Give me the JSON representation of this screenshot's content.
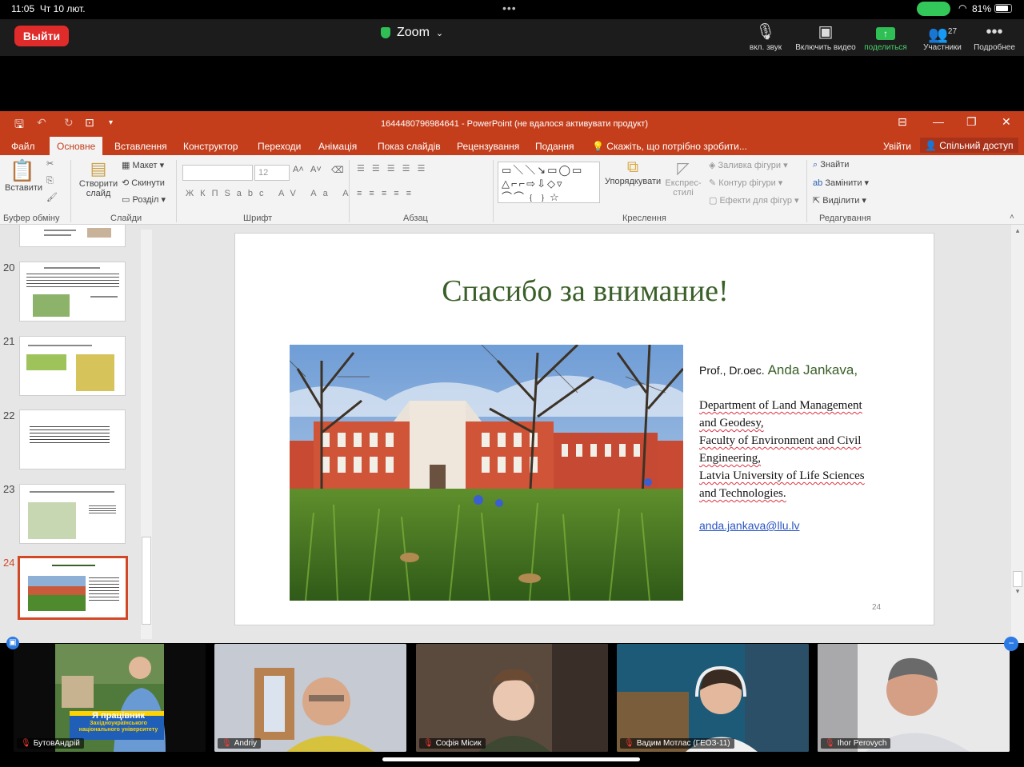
{
  "status": {
    "time": "11:05",
    "date": "Чт 10 лют.",
    "battery": "81%",
    "battery_level": 0.81
  },
  "zoom": {
    "leave_label": "Выйти",
    "title": "Zoom",
    "controls": [
      {
        "label": "вкл. звук",
        "icon": "mic-muted-icon"
      },
      {
        "label": "Включить видео",
        "icon": "video-off-icon"
      },
      {
        "label": "поделиться",
        "icon": "share-screen-icon"
      },
      {
        "label": "Участники",
        "icon": "participants-icon",
        "count": "27"
      },
      {
        "label": "Подробнее",
        "icon": "more-icon"
      }
    ]
  },
  "ppt": {
    "window_title": "1644480796984641 - PowerPoint (не вдалося активувати продукт)",
    "tabs": [
      "Файл",
      "Основне",
      "Вставлення",
      "Конструктор",
      "Переходи",
      "Анімація",
      "Показ слайдів",
      "Рецензування",
      "Подання"
    ],
    "active_tab": "Основне",
    "tell_me": "Скажіть, що потрібно зробити...",
    "signin": "Увійти",
    "share": "Спільний доступ",
    "ribbon": {
      "paste": "Вставити",
      "new_slide": "Створити слайд",
      "layout": "Макет",
      "reset": "Скинути",
      "section": "Розділ",
      "font_size": "12",
      "arrange": "Упорядкувати",
      "quick_styles": "Експрес-стилі",
      "shape_fill": "Заливка фігури",
      "shape_outline": "Контур фігури",
      "shape_effects": "Ефекти для фігур",
      "find": "Знайти",
      "replace": "Замінити",
      "select": "Виділити",
      "groups": {
        "clipboard": "Буфер обміну",
        "slides": "Слайди",
        "font": "Шрифт",
        "paragraph": "Абзац",
        "drawing": "Креслення",
        "editing": "Редагування"
      }
    },
    "thumbnails": [
      "20",
      "21",
      "22",
      "23",
      "24"
    ],
    "slide": {
      "title": "Спасибо за внимание!",
      "prof_prefix": "Prof., Dr.oec.",
      "prof_name": "Anda Jankava,",
      "dept_lines": [
        "Department of Land Management",
        "and Geodesy,",
        "Faculty of Environment and Civil",
        "Engineering,",
        "Latvia University of Life Sciences",
        "and Technologies."
      ],
      "email": "anda.jankava@llu.lv",
      "page_number": "24"
    }
  },
  "gallery": [
    {
      "name": "БутовАндрій",
      "banner_line1": "Я працівник",
      "banner_line2": "Західноукраїнського",
      "banner_line3": "національного університету"
    },
    {
      "name": "Andriy"
    },
    {
      "name": "Софія Місик"
    },
    {
      "name": "Вадим Мотлас (ГЕОЗ-11)"
    },
    {
      "name": "Ihor Perovych"
    }
  ]
}
